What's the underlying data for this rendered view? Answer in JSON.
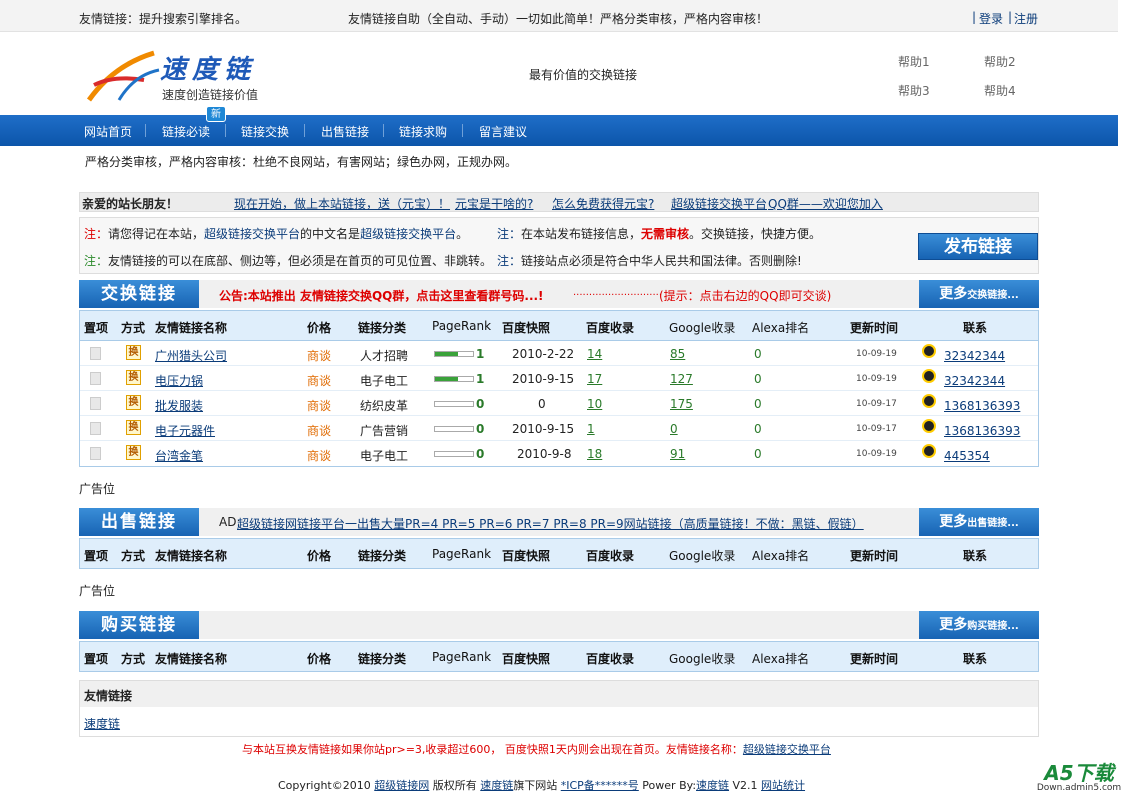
{
  "topbar": {
    "left": "友情链接：提升搜索引擎排名。",
    "center": "友情链接自助（全自动、手动）一切如此简单！严格分类审核，严格内容审核！",
    "login": "登录",
    "register": "注册",
    "sep": "|"
  },
  "header": {
    "logo_title": "速度链",
    "logo_slogan": "速度创造链接价值",
    "tagline": "最有价值的交换链接",
    "help": [
      "帮助1",
      "帮助2",
      "帮助3",
      "帮助4"
    ]
  },
  "nav": {
    "items": [
      "网站首页",
      "链接必读",
      "链接交换",
      "出售链接",
      "链接求购",
      "留言建议"
    ],
    "new_badge": "新"
  },
  "notice": "严格分类审核，严格内容审核：杜绝不良网站，有害网站；绿色办网，正规办网。",
  "greet": {
    "label": "亲爱的站长朋友！",
    "link1": "现在开始，做上本站链接，送（元宝）！",
    "link2": "元宝是干啥的?",
    "link3": "怎么免费获得元宝?",
    "link4_a": "超级链接交换平台",
    "link4_b": "QQ群——欢迎您加入"
  },
  "notes": {
    "prefix": "注：",
    "n1_a": "请您得记在本站，",
    "n1_b": "超级链接交换平台",
    "n1_c": "的中文名是",
    "n1_d": "超级链接交换平台",
    "n1_e": "。",
    "n2_a": "在本站发布链接信息，",
    "n2_b": "无需审核",
    "n2_c": "。交换链接，快捷方便。",
    "n3": "友情链接的可以在底部、侧边等，但必须是在首页的可见位置、非跳转。",
    "n4": "链接站点必须是符合中华人民共和国法律。否则删除!",
    "publish": "发布链接"
  },
  "sections": {
    "exchange": {
      "title": "交换链接",
      "announce": "公告:本站推出 友情链接交换QQ群，点击这里查看群号码...!",
      "dots": "............................",
      "hint": "(提示：点击右边的QQ即可交谈)",
      "more": "更多",
      "more_small": "交换链接..."
    },
    "sell": {
      "title": "出售链接",
      "ad_prefix": "AD:",
      "ad": "超级链接网链接平台一出售大量PR=4 PR=5 PR=6 PR=7 PR=8 PR=9网站链接（高质量链接！不做：黑链、假链）",
      "more": "更多",
      "more_small": "出售链接..."
    },
    "buy": {
      "title": "购买链接",
      "more": "更多",
      "more_small": "购买链接..."
    }
  },
  "table_headers": [
    "置项",
    "方式",
    "友情链接名称",
    "价格",
    "链接分类",
    "PageRank",
    "百度快照",
    "百度收录",
    "Google收录",
    "Alexa排名",
    "更新时间",
    "联系"
  ],
  "rows": [
    {
      "method": "换",
      "name": "广州猎头公司",
      "price": "商谈",
      "cat": "人才招聘",
      "pr": "1",
      "pr_level": 0.6,
      "snap": "2010-2-22",
      "baidu": "14",
      "google": "85",
      "alexa": "0",
      "time": "10-09-19",
      "qq": "32342344"
    },
    {
      "method": "换",
      "name": "电压力锅",
      "price": "商谈",
      "cat": "电子电工",
      "pr": "1",
      "pr_level": 0.6,
      "snap": "2010-9-15",
      "baidu": "17",
      "google": "127",
      "alexa": "0",
      "time": "10-09-19",
      "qq": "32342344"
    },
    {
      "method": "换",
      "name": "批发服装",
      "price": "商谈",
      "cat": "纺织皮革",
      "pr": "0",
      "pr_level": 0,
      "snap": "0",
      "baidu": "10",
      "google": "175",
      "alexa": "0",
      "time": "10-09-17",
      "qq": "1368136393"
    },
    {
      "method": "换",
      "name": "电子元器件",
      "price": "商谈",
      "cat": "广告营销",
      "pr": "0",
      "pr_level": 0,
      "snap": "2010-9-15",
      "baidu": "1",
      "google": "0",
      "alexa": "0",
      "time": "10-09-17",
      "qq": "1368136393"
    },
    {
      "method": "换",
      "name": "台湾金笔",
      "price": "商谈",
      "cat": "电子电工",
      "pr": "0",
      "pr_level": 0,
      "snap": "2010-9-8",
      "baidu": "18",
      "google": "91",
      "alexa": "0",
      "time": "10-09-19",
      "qq": "445354"
    }
  ],
  "ad_label": "广告位",
  "friend": {
    "title": "友情链接",
    "link": "速度链"
  },
  "footer": {
    "notice_a": "与本站互换友情链接如果你站pr>=3,收录超过600，  百度快照1天内则会出现在首页。友情链接名称：",
    "notice_link": "超级链接交换平台",
    "copy_a": "Copyright©2010 ",
    "copy_site": "超级链接网",
    "copy_b": " 版权所有 ",
    "copy_sub": "速度链",
    "copy_c": "旗下网站 ",
    "icp": "*ICP备******号",
    "power": " Power By:",
    "power_link": "速度链",
    "ver": " V2.1 ",
    "stats": "网站统计"
  },
  "watermark": {
    "main": "A5下载",
    "sub": "Down.admin5.com"
  }
}
